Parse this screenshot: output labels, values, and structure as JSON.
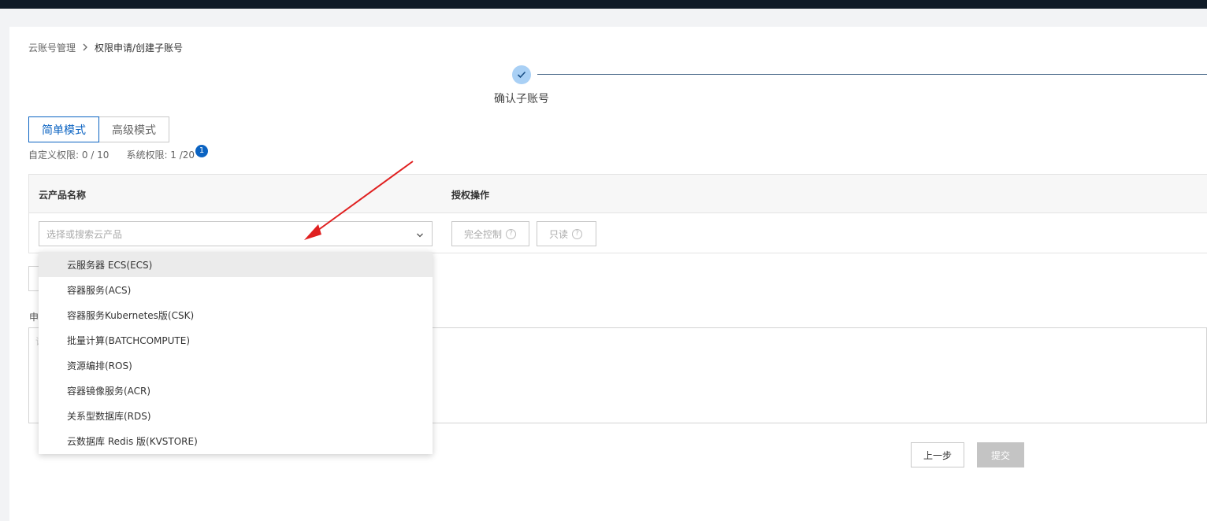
{
  "breadcrumb": {
    "root": "云账号管理",
    "current": "权限申请/创建子账号"
  },
  "steps": {
    "current_label": "确认子账号"
  },
  "mode_tabs": {
    "simple": "简单模式",
    "advanced": "高级模式"
  },
  "quota": {
    "custom": "自定义权限: 0 / 10",
    "system": "系统权限: 1 /20",
    "badge": "1"
  },
  "table": {
    "col_product": "云产品名称",
    "col_action": "授权操作"
  },
  "product_select": {
    "placeholder": "选择或搜索云产品"
  },
  "permission_buttons": {
    "full_control": "完全控制",
    "read_only": "只读"
  },
  "dropdown": {
    "items": [
      "云服务器 ECS(ECS)",
      "容器服务(ACS)",
      "容器服务Kubernetes版(CSK)",
      "批量计算(BATCHCOMPUTE)",
      "资源编排(ROS)",
      "容器镜像服务(ACR)",
      "关系型数据库(RDS)",
      "云数据库 Redis 版(KVSTORE)"
    ]
  },
  "apply_reason": {
    "label": "申",
    "placeholder": "请"
  },
  "footer": {
    "prev": "上一步",
    "submit": "提交"
  },
  "colors": {
    "accent": "#0b63c2",
    "topbar": "#0f1a27",
    "annotation_arrow": "#e02020"
  },
  "icons": {
    "breadcrumb_separator": "chevron-right-icon",
    "step_done": "check-icon",
    "select_caret": "chevron-down-icon",
    "help": "question-circle-icon"
  }
}
